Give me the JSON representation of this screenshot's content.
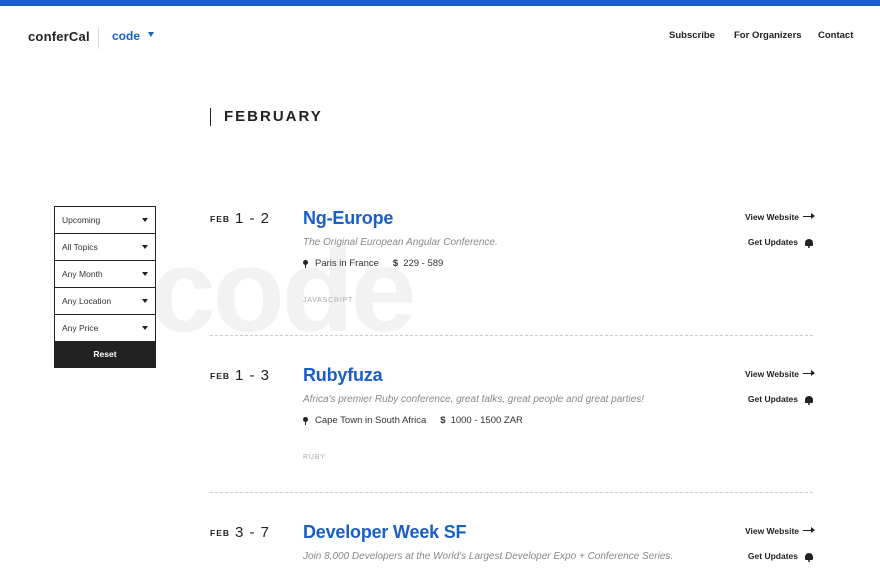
{
  "header": {
    "logo": "conferCal",
    "topic": "code",
    "nav": [
      "Subscribe",
      "For Organizers",
      "Contact"
    ]
  },
  "watermark": "code",
  "month_heading": "FEBRUARY",
  "filters": {
    "items": [
      "Upcoming",
      "All Topics",
      "Any Month",
      "Any Location",
      "Any Price"
    ],
    "reset_label": "Reset"
  },
  "events": [
    {
      "month": "FEB",
      "days": "1 - 2",
      "title": "Ng-Europe",
      "description": "The Original European Angular Conference.",
      "location": "Paris in France",
      "price": "229 - 589",
      "tag": "JAVASCRIPT",
      "website_label": "View Website",
      "updates_label": "Get Updates"
    },
    {
      "month": "FEB",
      "days": "1 - 3",
      "title": "Rubyfuza",
      "description": "Africa's premier Ruby conference, great talks, great people and great parties!",
      "location": "Cape Town in South Africa",
      "price": "1000 - 1500 ZAR",
      "tag": "RUBY",
      "website_label": "View Website",
      "updates_label": "Get Updates"
    },
    {
      "month": "FEB",
      "days": "3 - 7",
      "title": "Developer Week SF",
      "description": "Join 8,000 Developers at the World's Largest Developer Expo + Conference Series.",
      "website_label": "View Website",
      "updates_label": "Get Updates"
    }
  ],
  "colors": {
    "accent": "#1a5fc8",
    "dark": "#222222"
  }
}
